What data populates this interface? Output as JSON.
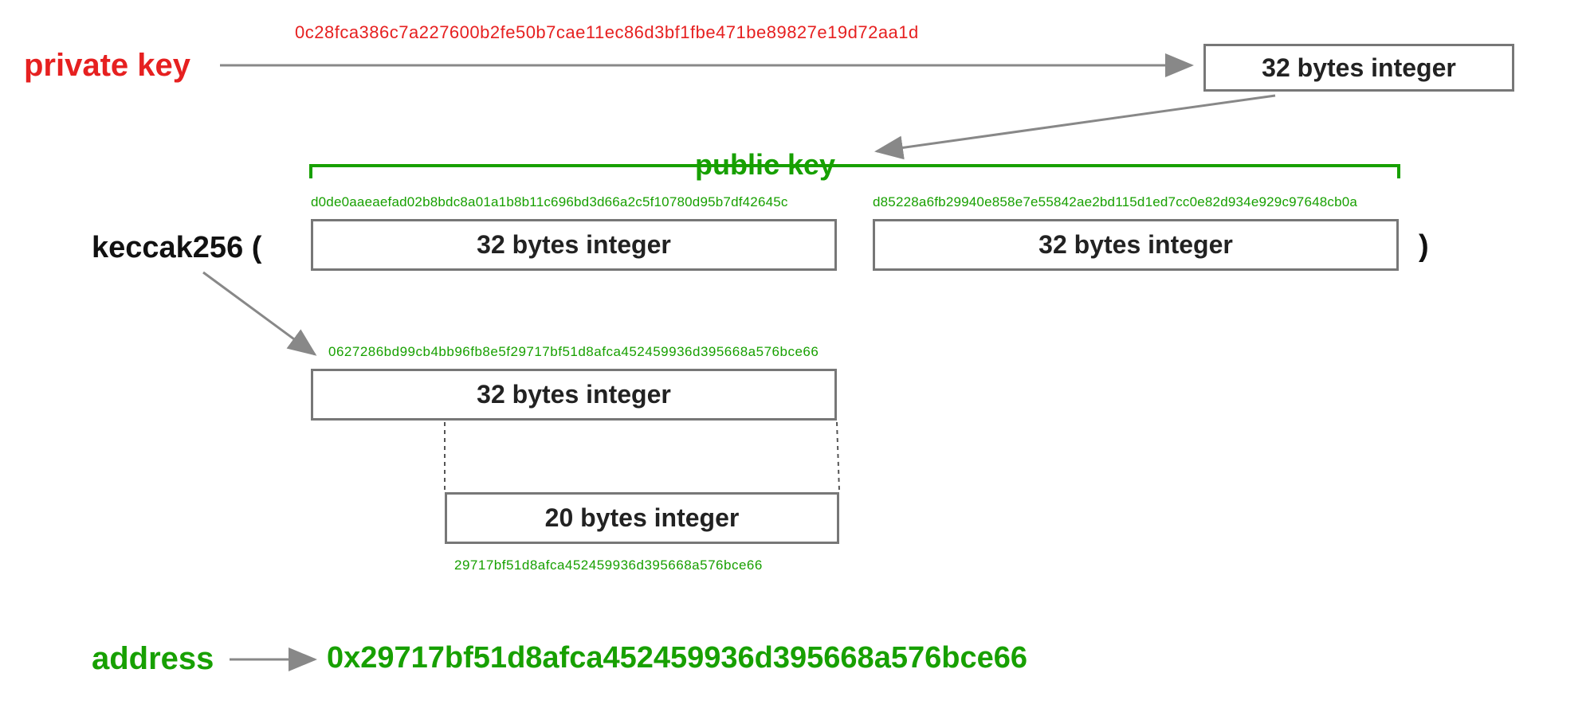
{
  "labels": {
    "private_key": "private key",
    "public_key": "public key",
    "keccak": "keccak256 (",
    "paren_close": ")",
    "address": "address"
  },
  "boxes": {
    "privkey_box": "32 bytes integer",
    "pubkey_x_box": "32 bytes integer",
    "pubkey_y_box": "32 bytes integer",
    "hash_box": "32 bytes integer",
    "addr_box": "20 bytes integer"
  },
  "hex": {
    "private_key": "0c28fca386c7a227600b2fe50b7cae11ec86d3bf1fbe471be89827e19d72aa1d",
    "pubkey_x": "d0de0aaeaefad02b8bdc8a01a1b8b11c696bd3d66a2c5f10780d95b7df42645c",
    "pubkey_y": "d85228a6fb29940e858e7e55842ae2bd115d1ed7cc0e82d934e929c97648cb0a",
    "keccak_hash": "0627286bd99cb4bb96fb8e5f29717bf51d8afca452459936d395668a576bce66",
    "address_bytes": "29717bf51d8afca452459936d395668a576bce66",
    "address_final": "0x29717bf51d8afca452459936d395668a576bce66"
  },
  "colors": {
    "red": "#e62020",
    "green": "#17a000",
    "gray_arrow": "#888888",
    "box_border": "#777777"
  }
}
